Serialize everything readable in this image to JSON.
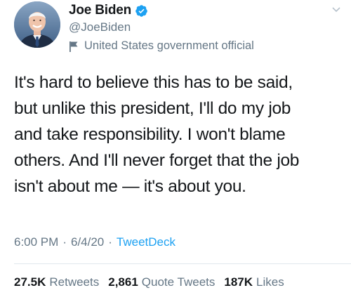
{
  "author": {
    "display_name": "Joe Biden",
    "handle": "@JoeBiden",
    "label": "United States government official",
    "verified": true,
    "verified_color": "#1da1f2"
  },
  "tweet": {
    "lines": [
      "It's hard to believe this has to be said,",
      "but unlike this president, I'll do my job",
      "and take responsibility. I won't blame",
      "others. And I'll never forget that the job",
      "isn't about me — it's about you."
    ]
  },
  "meta": {
    "time": "6:00 PM",
    "separator": "·",
    "date": "6/4/20",
    "source": "TweetDeck"
  },
  "stats": {
    "retweets_count": "27.5K",
    "retweets_label": "Retweets",
    "quotes_count": "2,861",
    "quotes_label": "Quote Tweets",
    "likes_count": "187K",
    "likes_label": "Likes"
  },
  "icons": {
    "avatar": "profile-photo",
    "verified": "verified-badge-icon",
    "label": "flag-icon",
    "menu": "chevron-down-icon"
  },
  "colors": {
    "text": "#14171a",
    "secondary": "#657786",
    "link": "#1da1f2",
    "divider": "#e1e8ed"
  }
}
